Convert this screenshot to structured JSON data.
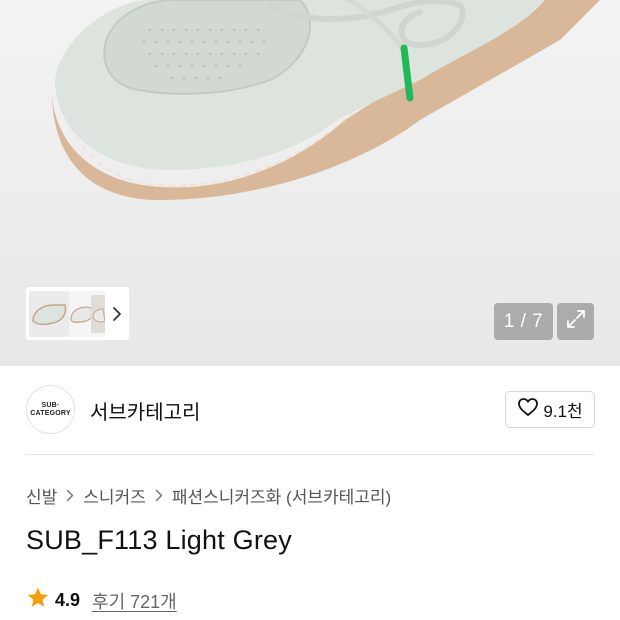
{
  "gallery": {
    "current": "1",
    "total": "7",
    "counter_text": "1 / 7",
    "icons": {
      "thumbnail_arrow": "chevron-right-icon",
      "expand": "expand-icon"
    }
  },
  "brand": {
    "logo_text_line1": "SUB·",
    "logo_text_line2": "CATEGORY",
    "name": "서브카테고리",
    "likes": "9.1천",
    "icons": {
      "like": "heart-icon"
    }
  },
  "breadcrumb": {
    "items": [
      "신발",
      "스니커즈",
      "패션스니커즈화 (서브카테고리)"
    ],
    "icons": {
      "separator": "chevron-right-icon"
    }
  },
  "product": {
    "title": "SUB_F113 Light Grey"
  },
  "rating": {
    "score": "4.9",
    "reviews": "후기 721개",
    "star_color": "#f59e0b"
  },
  "colors": {
    "lace_tip": "#22b85a",
    "overlay": "#787878"
  }
}
